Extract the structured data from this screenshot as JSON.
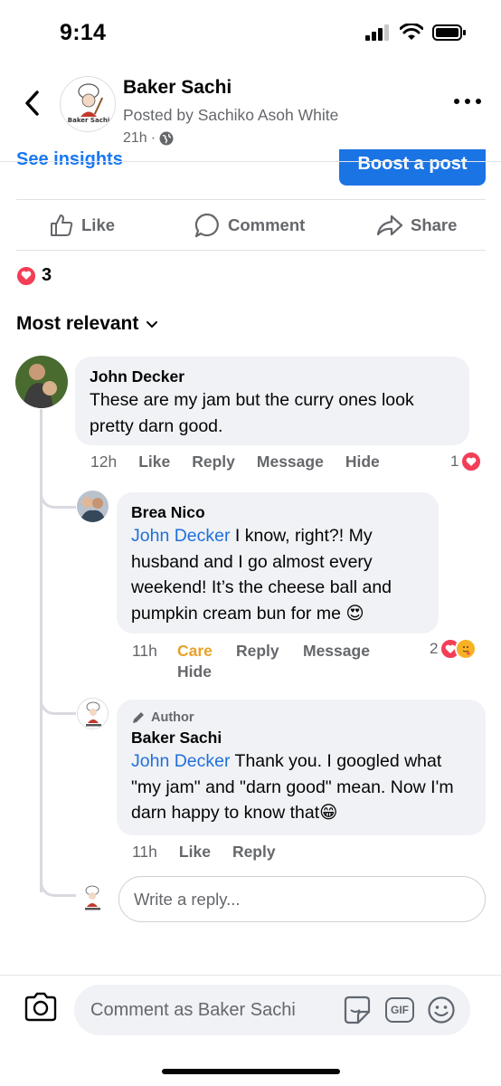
{
  "status_bar": {
    "time": "9:14"
  },
  "header": {
    "page_name": "Baker Sachi",
    "avatar_logo_text": "Baker Sachi",
    "posted_by": "Posted by Sachiko Asoh White",
    "time_ago": "21h",
    "separator": "·"
  },
  "insights": {
    "see_insights": "See insights",
    "boost": "Boost a post"
  },
  "actions": {
    "like": "Like",
    "comment": "Comment",
    "share": "Share"
  },
  "reactions": {
    "count": "3"
  },
  "sort": {
    "label": "Most relevant"
  },
  "comments": [
    {
      "author": "John Decker",
      "text": "These are my jam but the curry ones look pretty darn good.",
      "time": "12h",
      "actions": [
        "Like",
        "Reply",
        "Message",
        "Hide"
      ],
      "reaction_count": "1"
    },
    {
      "author": "Brea Nico",
      "mention": "John Decker",
      "text": " I know, right?! My husband and I go almost every weekend! It’s the cheese ball and pumpkin cream bun for me",
      "emoji": "😍",
      "time": "11h",
      "actions": [
        "Care",
        "Reply",
        "Message",
        "Hide"
      ],
      "reaction_count": "2"
    },
    {
      "badge": "Author",
      "author": "Baker Sachi",
      "mention": "John Decker",
      "text": " Thank you. I googled what \"my jam\" and \"darn good\" mean. Now I'm darn happy to know that",
      "emoji": "😁",
      "time": "11h",
      "actions": [
        "Like",
        "Reply"
      ]
    }
  ],
  "reply_box": {
    "placeholder": "Write a reply..."
  },
  "bottom": {
    "comment_placeholder": "Comment as Baker Sachi",
    "gif": "GIF"
  },
  "colors": {
    "accent": "#1877f2",
    "care": "#e8a22a",
    "heart": "#f33e58",
    "bubble": "#f0f2f5"
  }
}
